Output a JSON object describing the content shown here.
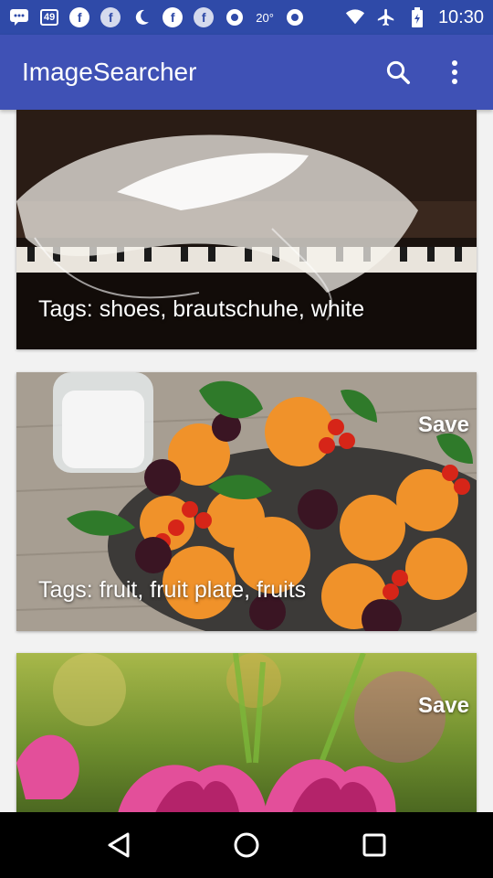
{
  "status_bar": {
    "notification_count": "49",
    "temperature": "20°",
    "time": "10:30"
  },
  "app_bar": {
    "title": "ImageSearcher"
  },
  "cards": [
    {
      "tags": "Tags: shoes, brautschuhe, white",
      "save_label": ""
    },
    {
      "tags": "Tags: fruit, fruit plate, fruits",
      "save_label": "Save"
    },
    {
      "tags": "",
      "save_label": "Save"
    }
  ],
  "icons": {
    "search": "search-icon",
    "overflow": "more-vert-icon",
    "back": "back-triangle-icon",
    "home": "home-circle-icon",
    "recents": "recents-square-icon"
  },
  "colors": {
    "primary": "#3f51b5",
    "primary_dark": "#2f4aa8"
  }
}
